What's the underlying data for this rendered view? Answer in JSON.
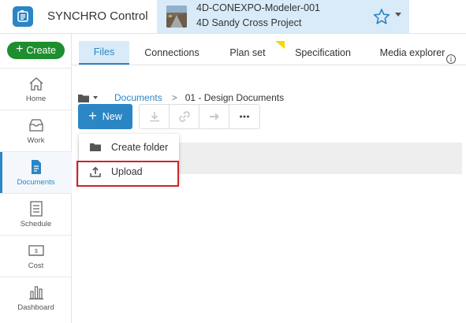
{
  "app": {
    "title": "SYNCHRO Control"
  },
  "project": {
    "name": "4D-CONEXPO-Modeler-001",
    "subtitle": "4D Sandy Cross Project"
  },
  "sidebar": {
    "create_label": "Create",
    "items": [
      {
        "label": "Home",
        "icon": "home-icon"
      },
      {
        "label": "Work",
        "icon": "inbox-icon"
      },
      {
        "label": "Documents",
        "icon": "document-icon",
        "active": true
      },
      {
        "label": "Schedule",
        "icon": "schedule-icon"
      },
      {
        "label": "Cost",
        "icon": "cost-icon"
      },
      {
        "label": "Dashboard",
        "icon": "dashboard-icon"
      }
    ]
  },
  "tabs": [
    {
      "label": "Files",
      "active": true
    },
    {
      "label": "Connections"
    },
    {
      "label": "Plan set"
    },
    {
      "label": "Specification"
    },
    {
      "label": "Media explorer"
    }
  ],
  "breadcrumb": {
    "root": "Documents",
    "separator": ">",
    "current": "01 - Design Documents"
  },
  "toolbar": {
    "new_label": "New"
  },
  "menu": {
    "items": [
      {
        "label": "Create folder",
        "icon": "folder-icon"
      },
      {
        "label": "Upload",
        "icon": "upload-icon"
      }
    ]
  },
  "info": {
    "glyph": "i"
  },
  "colors": {
    "accent": "#2b86c5",
    "create": "#1e8e2e",
    "highlight": "#d0232a",
    "tab_active_bg": "#d9ebf8"
  }
}
